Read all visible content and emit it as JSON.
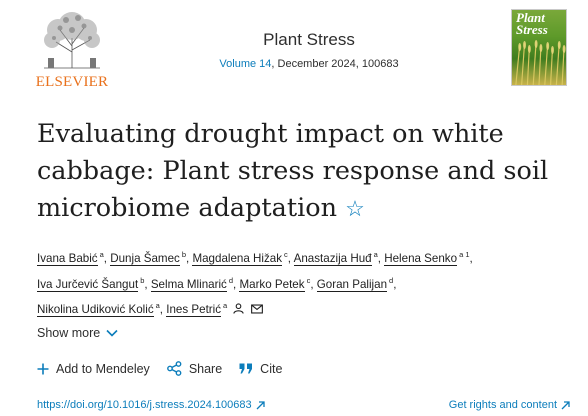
{
  "publisher": {
    "name": "ELSEVIER"
  },
  "journal": {
    "title": "Plant Stress",
    "volume_link": "Volume 14",
    "issue_rest": ", December 2024, 100683",
    "cover_title": "Plant\nStress"
  },
  "article": {
    "title": "Evaluating drought impact on white cabbage: Plant stress response and soil microbiome adaptation",
    "star": "☆"
  },
  "authors": [
    {
      "name": "Ivana Babić",
      "aff": "a"
    },
    {
      "name": "Dunja Šamec",
      "aff": "b"
    },
    {
      "name": "Magdalena Hižak",
      "aff": "c"
    },
    {
      "name": "Anastazija Huđ",
      "aff": "a"
    },
    {
      "name": "Helena Senko",
      "aff": "a 1"
    },
    {
      "name": "Iva Jurčević Šangut",
      "aff": "b"
    },
    {
      "name": "Selma Mlinarić",
      "aff": "d"
    },
    {
      "name": "Marko Petek",
      "aff": "c"
    },
    {
      "name": "Goran Palijan",
      "aff": "d"
    },
    {
      "name": "Nikolina Udiković Kolić",
      "aff": "a"
    },
    {
      "name": "Ines Petrić",
      "aff": "a"
    }
  ],
  "show_more": "Show more",
  "actions": {
    "mendeley": "Add to Mendeley",
    "share": "Share",
    "cite": "Cite"
  },
  "links": {
    "doi": "https://doi.org/10.1016/j.stress.2024.100683",
    "rights": "Get rights and content"
  },
  "colors": {
    "link": "#0c7dbb",
    "publisher_orange": "#e9711c"
  }
}
